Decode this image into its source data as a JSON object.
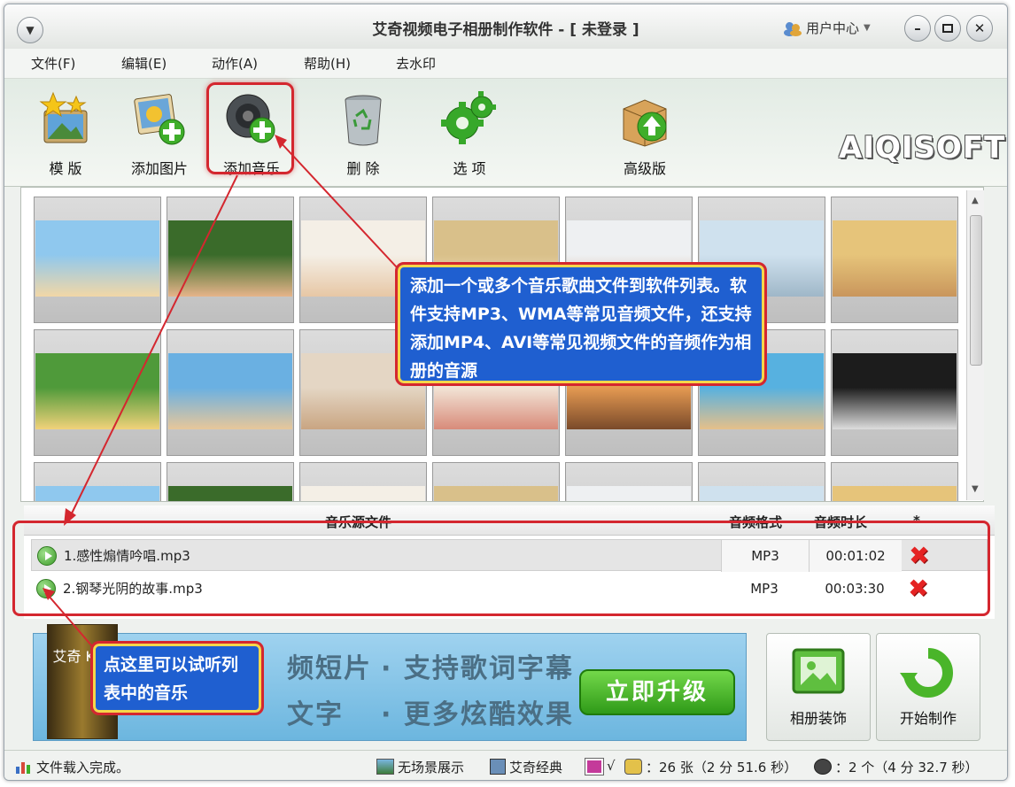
{
  "window": {
    "title": "艾奇视频电子相册制作软件 - [ 未登录 ]",
    "user_center": "用户中心"
  },
  "menu": {
    "file": "文件(F)",
    "edit": "编辑(E)",
    "action": "动作(A)",
    "help": "帮助(H)",
    "watermark": "去水印"
  },
  "toolbar": {
    "template": "模 版",
    "add_picture": "添加图片",
    "add_music": "添加音乐",
    "delete": "删 除",
    "options": "选 项",
    "advanced": "高级版",
    "logo": "AIQISOFT"
  },
  "music_list": {
    "headers": {
      "file": "音乐源文件",
      "format": "音频格式",
      "duration": "音频时长",
      "star": "*"
    },
    "rows": [
      {
        "name": "1.感性煽情吟唱.mp3",
        "format": "MP3",
        "duration": "00:01:02"
      },
      {
        "name": "2.钢琴光阴的故事.mp3",
        "format": "MP3",
        "duration": "00:03:30"
      }
    ]
  },
  "banner": {
    "line1a": "频短片",
    "line1b": "· 支持歌词字幕",
    "line2a": "文字",
    "line2b": "· 更多炫酷效果",
    "upgrade": "立即升级",
    "box_label": "艾奇 KTV"
  },
  "buttons": {
    "decorate": "相册装饰",
    "start": "开始制作"
  },
  "callouts": {
    "music_tip": "添加一个或多个音乐歌曲文件到软件列表。软件支持MP3、WMA等常见音频文件，还支持添加MP4、AVI等常见视频文件的音频作为相册的音源",
    "play_tip": "点这里可以试听列表中的音乐"
  },
  "status": {
    "loaded": "文件载入完成。",
    "scene": "无场景展示",
    "classic": "艾奇经典",
    "check": "√",
    "photos": "：26 张（2 分 51.6 秒）",
    "music": "：2 个（4 分 32.7 秒）"
  },
  "colors": {
    "accent_red": "#d4272f",
    "callout_blue": "#1f5fd0",
    "play_green": "#3d9b2a"
  }
}
